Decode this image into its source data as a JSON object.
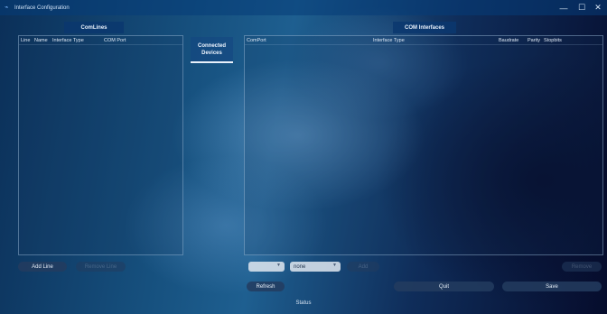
{
  "window": {
    "title": "Interface Configuration",
    "minimize": "—",
    "maximize": "☐",
    "close": "✕"
  },
  "comlines": {
    "header": "ComLines",
    "columns": [
      "Line",
      "Name",
      "Interface Type",
      "COM Port"
    ],
    "add_button": "Add Line",
    "remove_button": "Remove Line"
  },
  "connected_tab": {
    "label_line1": "Connected",
    "label_line2": "Devices"
  },
  "com_interfaces": {
    "header": "COM Interfaces",
    "columns": [
      "ComPort",
      "Interface Type",
      "Baudrate",
      "Parity",
      "Stopbits"
    ],
    "port_select_value": "",
    "type_select_value": "none",
    "add_button": "Add",
    "remove_button": "Remove"
  },
  "actions": {
    "refresh": "Refresh",
    "quit": "Quit",
    "save": "Save"
  },
  "status": "Status"
}
